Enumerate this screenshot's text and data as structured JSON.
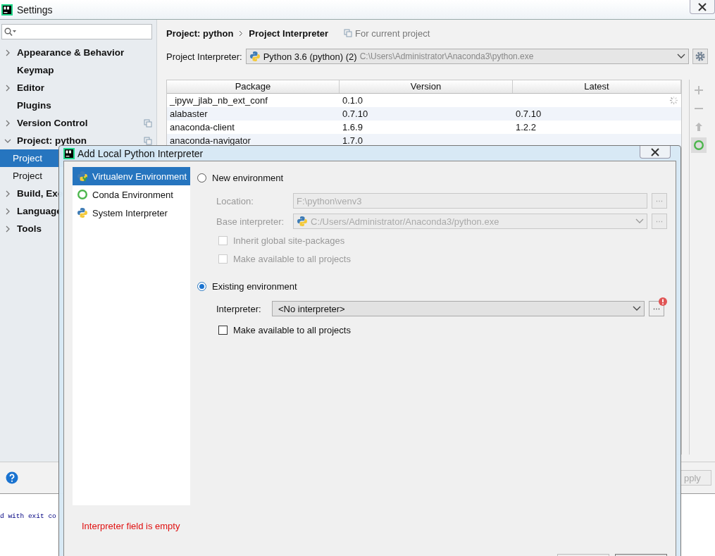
{
  "settings_window": {
    "title": "Settings"
  },
  "sidebar": {
    "items": [
      {
        "label": "Appearance & Behavior",
        "kind": "group",
        "expanded": false,
        "selected": false,
        "per_project": false
      },
      {
        "label": "Keymap",
        "kind": "page",
        "selected": false,
        "per_project": false
      },
      {
        "label": "Editor",
        "kind": "group",
        "expanded": false,
        "selected": false,
        "per_project": false
      },
      {
        "label": "Plugins",
        "kind": "page",
        "selected": false,
        "per_project": false
      },
      {
        "label": "Version Control",
        "kind": "group",
        "expanded": false,
        "selected": false,
        "per_project": true
      },
      {
        "label": "Project: python",
        "kind": "group",
        "expanded": true,
        "selected": false,
        "per_project": true,
        "children": [
          {
            "label": "Project",
            "selected": true
          },
          {
            "label": "Project",
            "selected": false
          }
        ]
      },
      {
        "label": "Build, Exe",
        "kind": "group",
        "expanded": false,
        "selected": false
      },
      {
        "label": "Language",
        "kind": "group",
        "expanded": false,
        "selected": false
      },
      {
        "label": "Tools",
        "kind": "group",
        "expanded": false,
        "selected": false
      }
    ]
  },
  "breadcrumb": [
    "Project: python",
    "Project Interpreter"
  ],
  "scope_note": "For current project",
  "interpreter": {
    "label": "Project Interpreter:",
    "name": "Python 3.6 (python) (2)",
    "path": "C:\\Users\\Administrator\\Anaconda3\\python.exe"
  },
  "table": {
    "columns": [
      "Package",
      "Version",
      "Latest"
    ],
    "rows": [
      {
        "cells": [
          "_ipyw_jlab_nb_ext_conf",
          "0.1.0",
          ""
        ],
        "loading": true
      },
      {
        "cells": [
          "alabaster",
          "0.7.10",
          "0.7.10"
        ],
        "loading": false
      },
      {
        "cells": [
          "anaconda-client",
          "1.6.9",
          "1.2.2"
        ],
        "loading": false
      },
      {
        "cells": [
          "anaconda-navigator",
          "1.7.0",
          ""
        ],
        "loading": false
      }
    ]
  },
  "apply_button": "pply",
  "console": "d with exit co",
  "dialog": {
    "title": "Add Local Python Interpreter",
    "env_types": [
      {
        "label": "Virtualenv Environment",
        "kind": "virtualenv",
        "selected": true
      },
      {
        "label": "Conda Environment",
        "kind": "conda",
        "selected": false
      },
      {
        "label": "System Interpreter",
        "kind": "system",
        "selected": false
      }
    ],
    "new_env": {
      "label": "New environment",
      "selected": false,
      "location_label": "Location:",
      "location": "F:\\python\\venv3",
      "base_label": "Base interpreter:",
      "base": "C:/Users/Administrator/Anaconda3/python.exe",
      "options": [
        {
          "label": "Inherit global site-packages",
          "checked": false
        },
        {
          "label": "Make available to all projects",
          "checked": false
        }
      ]
    },
    "existing_env": {
      "label": "Existing environment",
      "selected": true,
      "interpreter_label": "Interpreter:",
      "interpreter": "<No interpreter>",
      "error": true,
      "option": {
        "label": "Make available to all projects",
        "checked": false
      }
    },
    "error_message": "Interpreter field is empty"
  }
}
